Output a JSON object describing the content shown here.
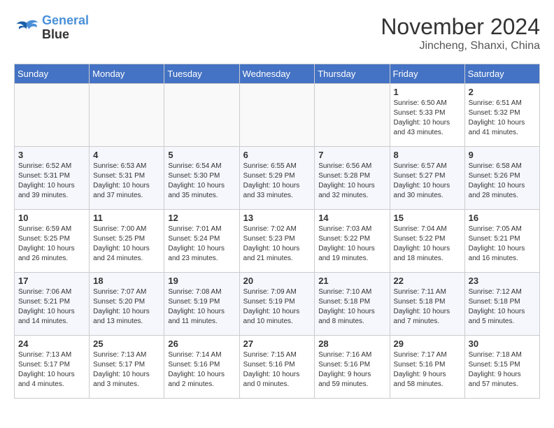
{
  "header": {
    "logo_line1": "General",
    "logo_line2": "Blue",
    "month": "November 2024",
    "location": "Jincheng, Shanxi, China"
  },
  "weekdays": [
    "Sunday",
    "Monday",
    "Tuesday",
    "Wednesday",
    "Thursday",
    "Friday",
    "Saturday"
  ],
  "weeks": [
    [
      {
        "day": "",
        "info": ""
      },
      {
        "day": "",
        "info": ""
      },
      {
        "day": "",
        "info": ""
      },
      {
        "day": "",
        "info": ""
      },
      {
        "day": "",
        "info": ""
      },
      {
        "day": "1",
        "info": "Sunrise: 6:50 AM\nSunset: 5:33 PM\nDaylight: 10 hours\nand 43 minutes."
      },
      {
        "day": "2",
        "info": "Sunrise: 6:51 AM\nSunset: 5:32 PM\nDaylight: 10 hours\nand 41 minutes."
      }
    ],
    [
      {
        "day": "3",
        "info": "Sunrise: 6:52 AM\nSunset: 5:31 PM\nDaylight: 10 hours\nand 39 minutes."
      },
      {
        "day": "4",
        "info": "Sunrise: 6:53 AM\nSunset: 5:31 PM\nDaylight: 10 hours\nand 37 minutes."
      },
      {
        "day": "5",
        "info": "Sunrise: 6:54 AM\nSunset: 5:30 PM\nDaylight: 10 hours\nand 35 minutes."
      },
      {
        "day": "6",
        "info": "Sunrise: 6:55 AM\nSunset: 5:29 PM\nDaylight: 10 hours\nand 33 minutes."
      },
      {
        "day": "7",
        "info": "Sunrise: 6:56 AM\nSunset: 5:28 PM\nDaylight: 10 hours\nand 32 minutes."
      },
      {
        "day": "8",
        "info": "Sunrise: 6:57 AM\nSunset: 5:27 PM\nDaylight: 10 hours\nand 30 minutes."
      },
      {
        "day": "9",
        "info": "Sunrise: 6:58 AM\nSunset: 5:26 PM\nDaylight: 10 hours\nand 28 minutes."
      }
    ],
    [
      {
        "day": "10",
        "info": "Sunrise: 6:59 AM\nSunset: 5:25 PM\nDaylight: 10 hours\nand 26 minutes."
      },
      {
        "day": "11",
        "info": "Sunrise: 7:00 AM\nSunset: 5:25 PM\nDaylight: 10 hours\nand 24 minutes."
      },
      {
        "day": "12",
        "info": "Sunrise: 7:01 AM\nSunset: 5:24 PM\nDaylight: 10 hours\nand 23 minutes."
      },
      {
        "day": "13",
        "info": "Sunrise: 7:02 AM\nSunset: 5:23 PM\nDaylight: 10 hours\nand 21 minutes."
      },
      {
        "day": "14",
        "info": "Sunrise: 7:03 AM\nSunset: 5:22 PM\nDaylight: 10 hours\nand 19 minutes."
      },
      {
        "day": "15",
        "info": "Sunrise: 7:04 AM\nSunset: 5:22 PM\nDaylight: 10 hours\nand 18 minutes."
      },
      {
        "day": "16",
        "info": "Sunrise: 7:05 AM\nSunset: 5:21 PM\nDaylight: 10 hours\nand 16 minutes."
      }
    ],
    [
      {
        "day": "17",
        "info": "Sunrise: 7:06 AM\nSunset: 5:21 PM\nDaylight: 10 hours\nand 14 minutes."
      },
      {
        "day": "18",
        "info": "Sunrise: 7:07 AM\nSunset: 5:20 PM\nDaylight: 10 hours\nand 13 minutes."
      },
      {
        "day": "19",
        "info": "Sunrise: 7:08 AM\nSunset: 5:19 PM\nDaylight: 10 hours\nand 11 minutes."
      },
      {
        "day": "20",
        "info": "Sunrise: 7:09 AM\nSunset: 5:19 PM\nDaylight: 10 hours\nand 10 minutes."
      },
      {
        "day": "21",
        "info": "Sunrise: 7:10 AM\nSunset: 5:18 PM\nDaylight: 10 hours\nand 8 minutes."
      },
      {
        "day": "22",
        "info": "Sunrise: 7:11 AM\nSunset: 5:18 PM\nDaylight: 10 hours\nand 7 minutes."
      },
      {
        "day": "23",
        "info": "Sunrise: 7:12 AM\nSunset: 5:18 PM\nDaylight: 10 hours\nand 5 minutes."
      }
    ],
    [
      {
        "day": "24",
        "info": "Sunrise: 7:13 AM\nSunset: 5:17 PM\nDaylight: 10 hours\nand 4 minutes."
      },
      {
        "day": "25",
        "info": "Sunrise: 7:13 AM\nSunset: 5:17 PM\nDaylight: 10 hours\nand 3 minutes."
      },
      {
        "day": "26",
        "info": "Sunrise: 7:14 AM\nSunset: 5:16 PM\nDaylight: 10 hours\nand 2 minutes."
      },
      {
        "day": "27",
        "info": "Sunrise: 7:15 AM\nSunset: 5:16 PM\nDaylight: 10 hours\nand 0 minutes."
      },
      {
        "day": "28",
        "info": "Sunrise: 7:16 AM\nSunset: 5:16 PM\nDaylight: 9 hours\nand 59 minutes."
      },
      {
        "day": "29",
        "info": "Sunrise: 7:17 AM\nSunset: 5:16 PM\nDaylight: 9 hours\nand 58 minutes."
      },
      {
        "day": "30",
        "info": "Sunrise: 7:18 AM\nSunset: 5:15 PM\nDaylight: 9 hours\nand 57 minutes."
      }
    ]
  ]
}
